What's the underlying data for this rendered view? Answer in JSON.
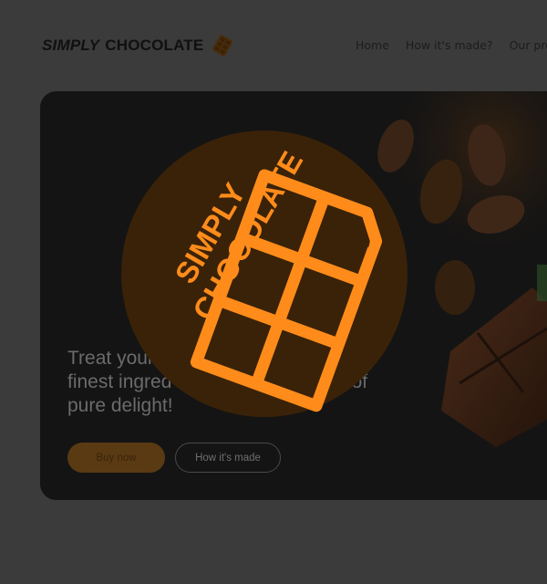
{
  "header": {
    "brand_simply": "SIMPLY",
    "brand_chocolate": "CHOCOLATE",
    "nav": [
      "Home",
      "How it's made?",
      "Our pro"
    ]
  },
  "hero": {
    "text_line1": "Treat your",
    "text_line1_end": "r",
    "text_line2": "finest ingred",
    "text_line2_end": "nt of",
    "text_line3": "pure delight!",
    "buy_label": "Buy now",
    "how_label": "How it's made"
  },
  "overlay": {
    "logo_line1": "SIMPLY",
    "logo_line2": "CHOCOLATE"
  },
  "colors": {
    "accent": "#ff8c1a",
    "circle": "#3a2208",
    "background": "#3b3b3b",
    "hero_bg": "#141414"
  },
  "icons": [
    "chocolate-bar-icon"
  ]
}
